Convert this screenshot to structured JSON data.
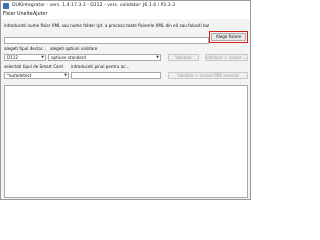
{
  "window": {
    "title": "DUKIntegrator - vers. 1.4.17.3.3 - D112 - vers. validator: J6.1.6 / P2.3.3"
  },
  "menu": {
    "items": [
      "Fisier",
      "Unelte",
      "Ajutor"
    ]
  },
  "instructions": "introduceti nume fisier XML sau nume folder (pt. a procesa toate fisierele XML din el) sau folositi butonul <Alege fisiere>",
  "file_browse": {
    "button_label": "Alege fisiere",
    "input_value": ""
  },
  "document_type": {
    "label": "alegeti tipul declar...",
    "selected": "D112"
  },
  "validation_options": {
    "label": "alegeti optiuni validare",
    "selected": "optiune standard"
  },
  "validate_button": "Validare",
  "validate_pdf_button": "Validare + creare ...",
  "smart_card": {
    "label": "selectati tipul de Smart Card",
    "selected": "*autodetect"
  },
  "pin": {
    "label": "introduceti pinul pentru ac...",
    "value": ""
  },
  "sign_button": "Validare + creare PDF semnat",
  "output": {
    "text": ""
  }
}
